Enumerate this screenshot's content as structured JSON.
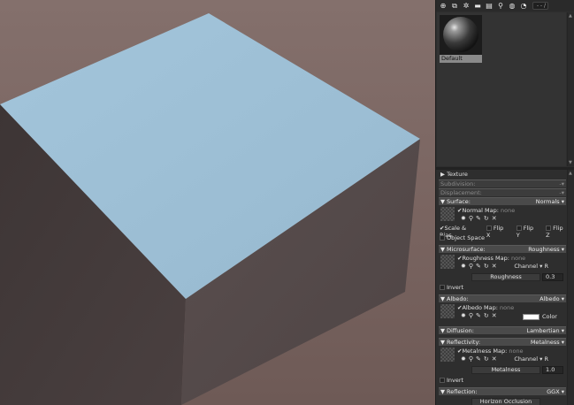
{
  "toolbar": {
    "icons": [
      "add-icon",
      "duplicate-icon",
      "settings-icon",
      "folder-icon",
      "delete-icon",
      "share-icon",
      "globe-icon",
      "settings-alt-icon"
    ],
    "search_text": "- - /"
  },
  "library": {
    "material_name": "Default"
  },
  "properties": {
    "texture": {
      "label": "Texture"
    },
    "subdivision": {
      "label": "Subdivision:"
    },
    "displacement": {
      "label": "Displacement:"
    },
    "surface": {
      "label": "Surface:",
      "value": "Normals",
      "map_label": "Normal Map:",
      "map_value": "none",
      "scale_bias": "Scale & Bias",
      "flip_x": "Flip X",
      "flip_y": "Flip Y",
      "flip_z": "Flip Z",
      "object_space": "Object Space"
    },
    "microsurface": {
      "label": "Microsurface:",
      "value": "Roughness",
      "map_label": "Roughness Map:",
      "map_value": "none",
      "channel_label": "Channel",
      "channel_value": "R",
      "slider_label": "Roughness",
      "slider_value": "0.3",
      "invert": "Invert"
    },
    "albedo": {
      "label": "Albedo:",
      "value": "Albedo",
      "map_label": "Albedo Map:",
      "map_value": "none",
      "color_label": "Color",
      "color": "#ffffff"
    },
    "diffusion": {
      "label": "Diffusion:",
      "value": "Lambertian"
    },
    "reflectivity": {
      "label": "Reflectivity:",
      "value": "Metalness",
      "map_label": "Metalness Map:",
      "map_value": "none",
      "channel_label": "Channel",
      "channel_value": "R",
      "slider_label": "Metalness",
      "slider_value": "1.0",
      "invert": "Invert"
    },
    "reflection": {
      "label": "Reflection:",
      "value": "GGX",
      "next_label": "Horizon Occlusion"
    }
  },
  "colors": {
    "cube_top": "#9ec0d6",
    "cube_side": "#4d4444",
    "viewport_bg": "#7b6662"
  }
}
